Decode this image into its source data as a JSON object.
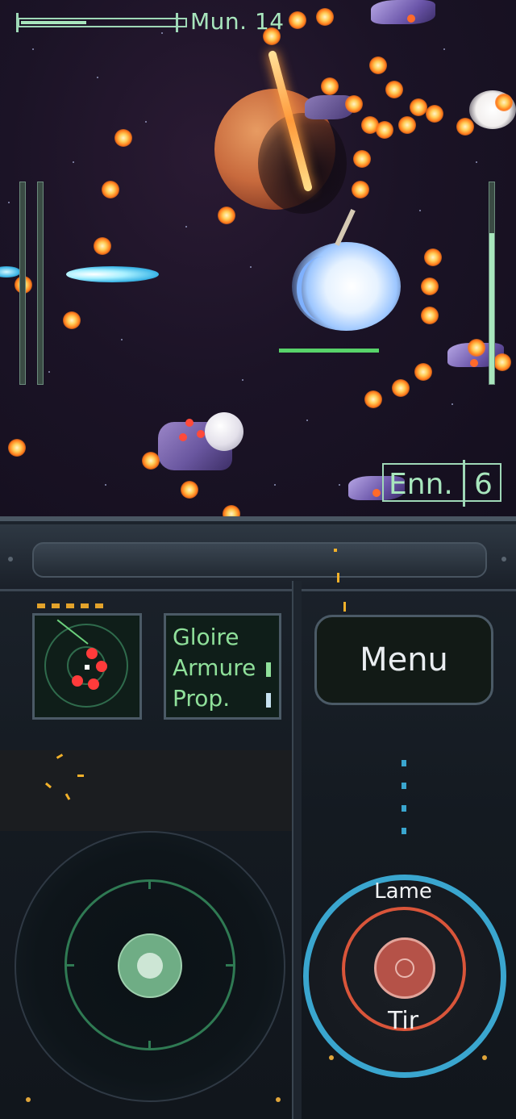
{
  "hud": {
    "ammo_label": "Mun. 14",
    "ammo_fraction": 0.4,
    "enemies_label": "Enn.",
    "enemies_count": "6",
    "left_gauges": [
      0.0,
      0.0
    ],
    "right_gauge_fraction": 0.75
  },
  "status": {
    "rows": [
      {
        "label": "Gloire",
        "level": 0
      },
      {
        "label": "Armure",
        "level": 0.15
      },
      {
        "label": "Prop.",
        "level": 0.15
      }
    ]
  },
  "menu": {
    "label": "Menu"
  },
  "controls": {
    "blade_label": "Lame",
    "fire_label": "Tir"
  },
  "colors": {
    "hud_green": "#a8e6bd",
    "status_green": "#8fe09a",
    "fire_blue": "#3aa6cf",
    "fire_red": "#d9553a",
    "bullet_orange": "#ff7a1a"
  },
  "icons": [
    "radar-icon",
    "joystick-icon",
    "fire-button-icon"
  ]
}
